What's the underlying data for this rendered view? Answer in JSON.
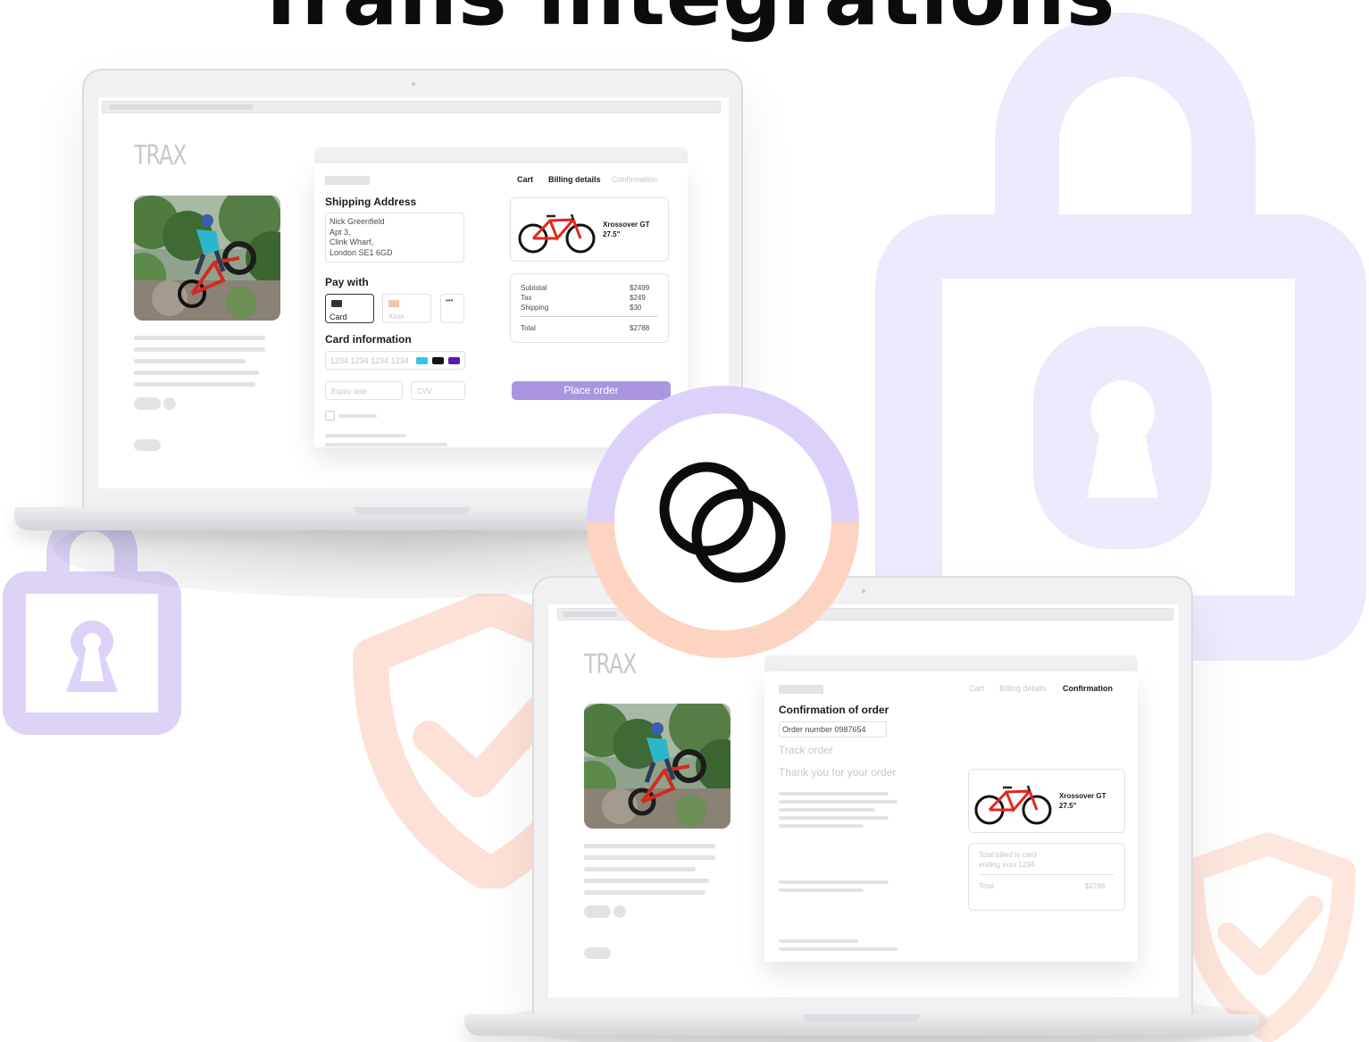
{
  "hero": {
    "title": "Trans integrations"
  },
  "colors": {
    "lavender": "#e9e2fb",
    "lavender_strong": "#d9cef6",
    "peach": "#fbd9c9",
    "accent_button": "#a995e2",
    "swatch_cyan": "#35c4ec",
    "swatch_black": "#111111",
    "swatch_purple": "#5b19b0"
  },
  "icons": {
    "big_lock": "lock-icon",
    "small_lock": "lock-icon",
    "shields": "shield-check-icon",
    "center": "linked-rings-icon"
  },
  "checkout": {
    "brand": "TRAX",
    "steps": [
      "Cart",
      "Billing details",
      "Confirmation"
    ],
    "shipping": {
      "title": "Shipping Address",
      "lines": [
        "Nick Greenfield",
        "Apt 3,",
        "Clink Wharf,",
        "London SE1 6GD"
      ]
    },
    "pay_with": {
      "title": "Pay with",
      "card_label": "Card",
      "alt_label": "Xxxx",
      "more_label": "•••"
    },
    "card_info": {
      "title": "Card information",
      "number_placeholder": "1234 1234 1234 1234",
      "expiry_placeholder": "Expiry date",
      "cvv_placeholder": "CVV"
    },
    "product": {
      "name_line1": "Xrossover GT",
      "name_line2": "27.5\""
    },
    "summary": {
      "rows": [
        {
          "label": "Subtotal",
          "value": "$2499"
        },
        {
          "label": "Tax",
          "value": "$249"
        },
        {
          "label": "Shipping",
          "value": "$30"
        }
      ],
      "total_label": "Total",
      "total_value": "$2788"
    },
    "place_order": "Place order"
  },
  "confirmation": {
    "brand": "TRAX",
    "steps": [
      "Cart",
      "Billing details",
      "Confirmation"
    ],
    "title": "Confirmation of order",
    "order_number": "Order number 0987654",
    "track_order": "Track order",
    "thank_you": "Thank you for your order",
    "product": {
      "name_line1": "Xrossover GT",
      "name_line2": "27.5\""
    },
    "billed_line1": "Total billed to card",
    "billed_line2": "ending xxxx 1234",
    "total_label": "Total",
    "total_value": "$2788"
  }
}
